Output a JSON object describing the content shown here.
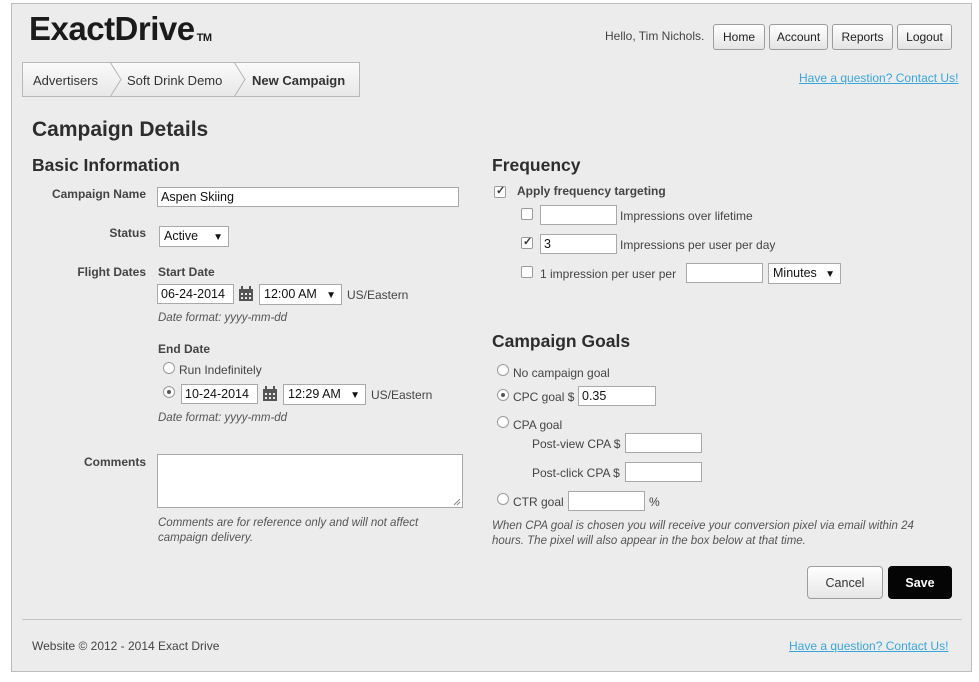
{
  "header": {
    "logo": "ExactDrive",
    "logo_tm": "TM",
    "greeting": "Hello, Tim Nichols.",
    "nav": [
      "Home",
      "Account",
      "Reports",
      "Logout"
    ]
  },
  "breadcrumb": [
    "Advertisers",
    "Soft Drink Demo",
    "New Campaign"
  ],
  "help_link": "Have a question? Contact Us!",
  "page_title": "Campaign Details",
  "basic": {
    "heading": "Basic Information",
    "campaign_name_label": "Campaign Name",
    "campaign_name_value": "Aspen Skiing",
    "status_label": "Status",
    "status_value": "Active",
    "flight_dates_label": "Flight Dates",
    "start_date_label": "Start Date",
    "start_date": "06-24-2014",
    "start_time": "12:00 AM",
    "timezone": "US/Eastern",
    "date_format_hint": "Date format: yyyy-mm-dd",
    "end_date_label": "End Date",
    "run_indefinitely": "Run Indefinitely",
    "end_date": "10-24-2014",
    "end_time": "12:29 AM",
    "comments_label": "Comments",
    "comments_hint": "Comments are for reference only and will not affect campaign delivery."
  },
  "frequency": {
    "heading": "Frequency",
    "apply_label": "Apply frequency targeting",
    "apply_checked": true,
    "lifetime_label": "Impressions over lifetime",
    "lifetime_value": "",
    "per_day_label": "Impressions per user per day",
    "per_day_value": "3",
    "per_user_label": "1 impression per user per",
    "per_user_value": "",
    "per_user_unit": "Minutes"
  },
  "goals": {
    "heading": "Campaign Goals",
    "no_goal": "No campaign goal",
    "cpc_label": "CPC goal $",
    "cpc_value": "0.35",
    "cpa_label": "CPA goal",
    "post_view": "Post-view CPA $",
    "post_click": "Post-click CPA $",
    "ctr_label": "CTR goal",
    "ctr_unit": "%",
    "note": "When CPA goal is chosen you will receive your conversion pixel via email within 24 hours. The pixel will also appear in the box below at that time."
  },
  "actions": {
    "cancel": "Cancel",
    "save": "Save"
  },
  "footer": {
    "copyright": "Website © 2012 - 2014 Exact Drive",
    "help_link": "Have a question? Contact Us!"
  }
}
